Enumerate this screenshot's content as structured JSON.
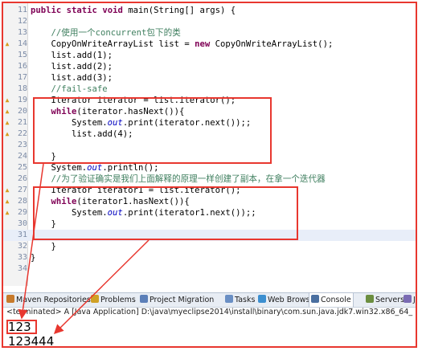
{
  "editor": {
    "lines": [
      {
        "n": "11",
        "code": "public static void main(String[] args) {"
      },
      {
        "n": "12",
        "code": ""
      },
      {
        "n": "13",
        "code": "    //使用一个concurrent包下的类"
      },
      {
        "n": "14",
        "code": "    CopyOnWriteArrayList list = new CopyOnWriteArrayList();"
      },
      {
        "n": "15",
        "code": "    list.add(1);"
      },
      {
        "n": "16",
        "code": "    list.add(2);"
      },
      {
        "n": "17",
        "code": "    list.add(3);"
      },
      {
        "n": "18",
        "code": "    //fail-safe"
      },
      {
        "n": "19",
        "code": "    Iterator iterator = list.iterator();"
      },
      {
        "n": "20",
        "code": "    while(iterator.hasNext()){"
      },
      {
        "n": "21",
        "code": "        System.out.print(iterator.next());;"
      },
      {
        "n": "22",
        "code": "        list.add(4);"
      },
      {
        "n": "23",
        "code": ""
      },
      {
        "n": "24",
        "code": "    }"
      },
      {
        "n": "25",
        "code": "    System.out.println();"
      },
      {
        "n": "26",
        "code": "    //为了验证确实是我们上面解释的原理一样创建了副本，在拿一个迭代器"
      },
      {
        "n": "27",
        "code": "    Iterator iterator1 = list.iterator();"
      },
      {
        "n": "28",
        "code": "    while(iterator1.hasNext()){"
      },
      {
        "n": "29",
        "code": "        System.out.print(iterator1.next());;"
      },
      {
        "n": "30",
        "code": "    }"
      },
      {
        "n": "31",
        "code": ""
      },
      {
        "n": "32",
        "code": "    }"
      },
      {
        "n": "33",
        "code": "}"
      },
      {
        "n": "34",
        "code": ""
      }
    ]
  },
  "bottom_tabs": [
    {
      "label": "Maven Repositories",
      "icon": "maven-icon",
      "color": "#c77a2c"
    },
    {
      "label": "Problems",
      "icon": "problems-icon",
      "color": "#d0a126"
    },
    {
      "label": "Project Migration",
      "icon": "migration-icon",
      "color": "#5b7fb8"
    },
    {
      "label": "Tasks",
      "icon": "tasks-icon",
      "color": "#6a8fc4"
    },
    {
      "label": "Web Browser",
      "icon": "globe-icon",
      "color": "#3c8fd0"
    },
    {
      "label": "Console",
      "icon": "console-icon",
      "color": "#4a6fa0",
      "active": true
    },
    {
      "label": "Servers",
      "icon": "servers-icon",
      "color": "#6b8e3f"
    },
    {
      "label": "Ju",
      "icon": "junit-icon",
      "color": "#7a6bb3"
    }
  ],
  "console": {
    "status": "<terminated> A [Java Application] D:\\java\\myeclipse2014\\install\\binary\\com.sun.java.jdk7.win32.x86_64_1.",
    "output_line1": "123",
    "output_line2": "123444"
  },
  "colors": {
    "keyword": "#7f0055",
    "comment": "#3f7f5f",
    "field": "#0000c0",
    "annotation_red": "#e8372f"
  }
}
